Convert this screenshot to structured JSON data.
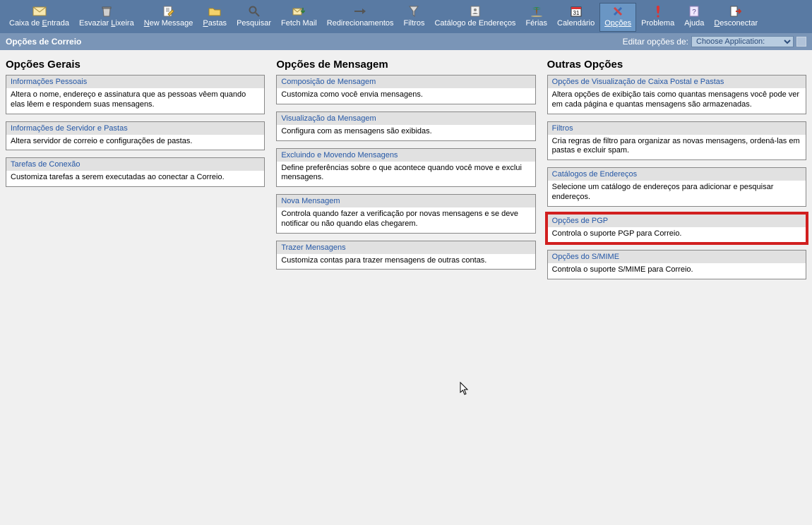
{
  "toolbar": [
    {
      "id": "inbox",
      "label": "Caixa de Entrada",
      "accelIndex": 9,
      "icon": "mail",
      "active": false
    },
    {
      "id": "trash",
      "label": "Esvaziar Lixeira",
      "accelIndex": 9,
      "icon": "trash",
      "active": false
    },
    {
      "id": "new",
      "label": "New Message",
      "accelIndex": 0,
      "icon": "compose",
      "active": false
    },
    {
      "id": "folders",
      "label": "Pastas",
      "accelIndex": 0,
      "icon": "folder",
      "active": false
    },
    {
      "id": "search",
      "label": "Pesquisar",
      "accelIndex": -1,
      "icon": "search",
      "active": false
    },
    {
      "id": "fetch",
      "label": "Fetch Mail",
      "accelIndex": -1,
      "icon": "fetch",
      "active": false
    },
    {
      "id": "redirect",
      "label": "Redirecionamentos",
      "accelIndex": -1,
      "icon": "arrow",
      "active": false
    },
    {
      "id": "filters",
      "label": "Filtros",
      "accelIndex": -1,
      "icon": "funnel",
      "active": false
    },
    {
      "id": "contacts",
      "label": "Catálogo de Endereços",
      "accelIndex": -1,
      "icon": "addressbook",
      "active": false
    },
    {
      "id": "vacation",
      "label": "Férias",
      "accelIndex": -1,
      "icon": "vacation",
      "active": false
    },
    {
      "id": "calendar",
      "label": "Calendário",
      "accelIndex": -1,
      "icon": "calendar",
      "active": false
    },
    {
      "id": "options",
      "label": "Opções",
      "accelIndex": 0,
      "icon": "options",
      "active": true
    },
    {
      "id": "problem",
      "label": "Problema",
      "accelIndex": -1,
      "icon": "alert",
      "active": false
    },
    {
      "id": "help",
      "label": "Ajuda",
      "accelIndex": -1,
      "icon": "help",
      "active": false
    },
    {
      "id": "logout",
      "label": "Desconectar",
      "accelIndex": 0,
      "icon": "logout",
      "active": false
    }
  ],
  "subheader": {
    "title": "Opções de Correio",
    "edit_label": "Editar opções de:",
    "select_text": "Choose Application:"
  },
  "columns": [
    {
      "heading": "Opções Gerais",
      "boxes": [
        {
          "title": "Informações Pessoais",
          "desc": "Altera o nome, endereço e assinatura que as pessoas vêem quando elas lêem e respondem suas mensagens.",
          "highlight": false
        },
        {
          "title": "Informações de Servidor e Pastas",
          "desc": "Altera servidor de correio e configurações de pastas.",
          "highlight": false
        },
        {
          "title": "Tarefas de Conexão",
          "desc": "Customiza tarefas a serem executadas ao conectar a Correio.",
          "highlight": false
        }
      ]
    },
    {
      "heading": "Opções de Mensagem",
      "boxes": [
        {
          "title": "Composição de Mensagem",
          "desc": "Customiza como você envia mensagens.",
          "highlight": false
        },
        {
          "title": "Visualização da Mensagem",
          "desc": "Configura com as mensagens são exibidas.",
          "highlight": false
        },
        {
          "title": "Excluindo e Movendo Mensagens",
          "desc": "Define preferências sobre o que acontece quando você move e exclui mensagens.",
          "highlight": false
        },
        {
          "title": "Nova Mensagem",
          "desc": "Controla quando fazer a verificação por novas mensagens e se deve notificar ou não quando elas chegarem.",
          "highlight": false
        },
        {
          "title": "Trazer Mensagens",
          "desc": "Customiza contas para trazer mensagens de outras contas.",
          "highlight": false
        }
      ]
    },
    {
      "heading": "Outras Opções",
      "boxes": [
        {
          "title": "Opções de Visualização de Caixa Postal e Pastas",
          "desc": "Altera opções de exibição tais como quantas mensagens você pode ver em cada página e quantas mensagens são armazenadas.",
          "highlight": false
        },
        {
          "title": "Filtros",
          "desc": "Cria regras de filtro para organizar as novas mensagens, ordená-las em pastas e excluir spam.",
          "highlight": false
        },
        {
          "title": "Catálogos de Endereços",
          "desc": "Selecione um catálogo de endereços para adicionar e pesquisar endereços.",
          "highlight": false
        },
        {
          "title": "Opções de PGP",
          "desc": "Controla o suporte PGP para Correio.",
          "highlight": true
        },
        {
          "title": "Opções do S/MIME",
          "desc": "Controla o suporte S/MIME para Correio.",
          "highlight": false
        }
      ]
    }
  ]
}
